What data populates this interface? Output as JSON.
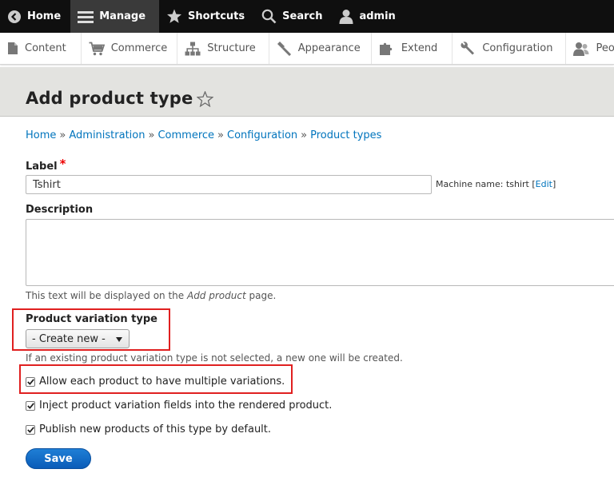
{
  "toolbar": {
    "home": "Home",
    "manage": "Manage",
    "shortcuts": "Shortcuts",
    "search": "Search",
    "user": "admin"
  },
  "tray": [
    "Content",
    "Commerce",
    "Structure",
    "Appearance",
    "Extend",
    "Configuration",
    "People"
  ],
  "page": {
    "title": "Add product type"
  },
  "breadcrumb": [
    "Home",
    "Administration",
    "Commerce",
    "Configuration",
    "Product types"
  ],
  "breadcrumb_sep": "»",
  "form": {
    "label_title": "Label",
    "label_required": "*",
    "label_value": "Tshirt",
    "machine_prefix": "Machine name: tshirt [",
    "machine_edit": "Edit",
    "machine_suffix": "]",
    "description_title": "Description",
    "description_help_pre": "This text will be displayed on the ",
    "description_help_em": "Add product",
    "description_help_post": " page.",
    "variation_title": "Product variation type",
    "variation_value": "- Create new -",
    "variation_help": "If an existing product variation type is not selected, a new one will be created.",
    "check_multiple": "Allow each product to have multiple variations.",
    "check_inject": "Inject product variation fields into the rendered product.",
    "check_publish": "Publish new products of this type by default.",
    "save": "Save"
  },
  "colors": {
    "link": "#0074bd",
    "highlight": "#e02020",
    "button": "#0a5cb8"
  }
}
